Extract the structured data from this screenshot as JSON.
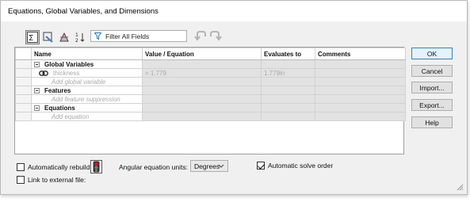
{
  "window": {
    "title": "Equations, Global Variables, and Dimensions"
  },
  "toolbar": {
    "filter_placeholder": "Filter All Fields",
    "buttons": [
      "equation-view-icon",
      "sketch-equation-view-icon",
      "dimension-view-icon",
      "ordered-view-icon"
    ]
  },
  "table": {
    "columns": [
      "Name",
      "Value / Equation",
      "Evaluates to",
      "Comments"
    ],
    "sections": {
      "global": {
        "label": "Global Variables",
        "var_name": "thickness",
        "var_value": "= 1.779",
        "var_eval": "1.779in",
        "add": "Add global variable"
      },
      "features": {
        "label": "Features",
        "add": "Add feature suppression"
      },
      "equations": {
        "label": "Equations",
        "add": "Add equation"
      }
    }
  },
  "buttons": {
    "ok": "OK",
    "cancel": "Cancel",
    "import": "Import...",
    "export": "Export...",
    "help": "Help"
  },
  "footer": {
    "auto_rebuild": "Automatically rebuild",
    "angular_units_label": "Angular equation units:",
    "angular_units_value": "Degrees",
    "auto_solve": "Automatic solve order",
    "link_external": "Link to external file:"
  }
}
